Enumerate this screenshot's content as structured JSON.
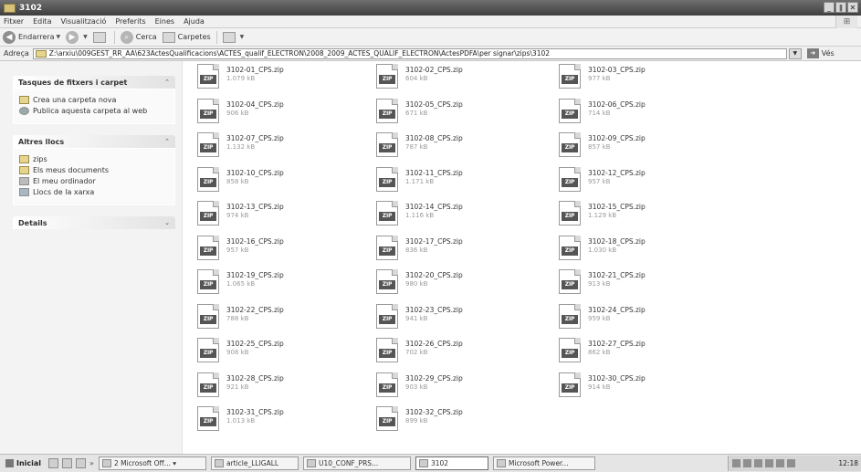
{
  "window": {
    "title": "3102",
    "controls": [
      "_",
      "ǁ",
      "✕"
    ]
  },
  "menu": [
    "Fitxer",
    "Edita",
    "Visualització",
    "Preferits",
    "Eines",
    "Ajuda"
  ],
  "toolbar": {
    "back_label": "Endarrera",
    "search_label": "Cerca",
    "folders_label": "Carpetes"
  },
  "address": {
    "label": "Adreça",
    "path": "Z:\\arxiu\\009GEST_RR_AA\\623ActesQualificacions\\ACTES_qualif_ELECTRON\\2008_2009_ACTES_QUALIF_ELECTRON\\ActesPDFA\\per signar\\zips\\3102",
    "go_label": "Vés"
  },
  "panels": {
    "tasks": {
      "title": "Tasques de fitxers i carpet",
      "items": [
        {
          "label": "Crea una carpeta nova",
          "icon": "new-folder-icon"
        },
        {
          "label": "Publica aquesta carpeta al web",
          "icon": "globe-icon"
        }
      ]
    },
    "places": {
      "title": "Altres llocs",
      "items": [
        {
          "label": "zips",
          "icon": "folder-icon"
        },
        {
          "label": "Els meus documents",
          "icon": "folder-icon"
        },
        {
          "label": "El meu ordinador",
          "icon": "computer-icon"
        },
        {
          "label": "Llocs de la xarxa",
          "icon": "network-icon"
        }
      ]
    },
    "details": {
      "title": "Details"
    }
  },
  "zip_badge": "ZIP",
  "files": [
    {
      "name": "3102-01_CPS.zip",
      "size": "1.079 kB"
    },
    {
      "name": "3102-02_CPS.zip",
      "size": "604 kB"
    },
    {
      "name": "3102-03_CPS.zip",
      "size": "977 kB"
    },
    {
      "name": "3102-04_CPS.zip",
      "size": "906 kB"
    },
    {
      "name": "3102-05_CPS.zip",
      "size": "671 kB"
    },
    {
      "name": "3102-06_CPS.zip",
      "size": "714 kB"
    },
    {
      "name": "3102-07_CPS.zip",
      "size": "1.132 kB"
    },
    {
      "name": "3102-08_CPS.zip",
      "size": "787 kB"
    },
    {
      "name": "3102-09_CPS.zip",
      "size": "857 kB"
    },
    {
      "name": "3102-10_CPS.zip",
      "size": "858 kB"
    },
    {
      "name": "3102-11_CPS.zip",
      "size": "1.171 kB"
    },
    {
      "name": "3102-12_CPS.zip",
      "size": "957 kB"
    },
    {
      "name": "3102-13_CPS.zip",
      "size": "974 kB"
    },
    {
      "name": "3102-14_CPS.zip",
      "size": "1.116 kB"
    },
    {
      "name": "3102-15_CPS.zip",
      "size": "1.129 kB"
    },
    {
      "name": "3102-16_CPS.zip",
      "size": "957 kB"
    },
    {
      "name": "3102-17_CPS.zip",
      "size": "836 kB"
    },
    {
      "name": "3102-18_CPS.zip",
      "size": "1.030 kB"
    },
    {
      "name": "3102-19_CPS.zip",
      "size": "1.065 kB"
    },
    {
      "name": "3102-20_CPS.zip",
      "size": "980 kB"
    },
    {
      "name": "3102-21_CPS.zip",
      "size": "913 kB"
    },
    {
      "name": "3102-22_CPS.zip",
      "size": "788 kB"
    },
    {
      "name": "3102-23_CPS.zip",
      "size": "941 kB"
    },
    {
      "name": "3102-24_CPS.zip",
      "size": "959 kB"
    },
    {
      "name": "3102-25_CPS.zip",
      "size": "908 kB"
    },
    {
      "name": "3102-26_CPS.zip",
      "size": "702 kB"
    },
    {
      "name": "3102-27_CPS.zip",
      "size": "862 kB"
    },
    {
      "name": "3102-28_CPS.zip",
      "size": "921 kB"
    },
    {
      "name": "3102-29_CPS.zip",
      "size": "903 kB"
    },
    {
      "name": "3102-30_CPS.zip",
      "size": "914 kB"
    },
    {
      "name": "3102-31_CPS.zip",
      "size": "1.013 kB"
    },
    {
      "name": "3102-32_CPS.zip",
      "size": "899 kB"
    }
  ],
  "taskbar": {
    "start_label": "Inicial",
    "quick_more": "»",
    "buttons": [
      {
        "label": "2 Microsoft Off... ▾",
        "active": false
      },
      {
        "label": "article_LLIGALL",
        "active": false
      },
      {
        "label": "U10_CONF_PRS...",
        "active": false
      },
      {
        "label": "3102",
        "active": true
      },
      {
        "label": "Microsoft Power...",
        "active": false
      }
    ],
    "clock": "12:18"
  }
}
